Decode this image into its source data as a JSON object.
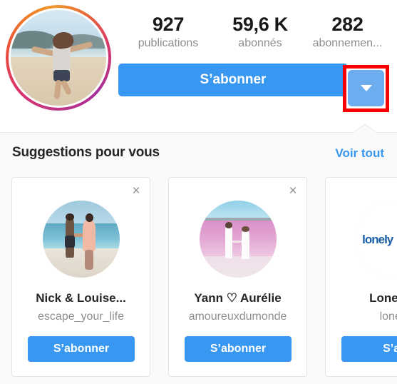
{
  "profile": {
    "avatar_alt": "woman running on beach",
    "has_story_ring": true,
    "stats": [
      {
        "value": "927",
        "label": "publications"
      },
      {
        "value": "59,6 K",
        "label": "abonnés"
      },
      {
        "value": "282",
        "label": "abonnemen..."
      }
    ],
    "follow_label": "S’abonner",
    "dropdown_icon": "chevron-down-icon"
  },
  "annotation": {
    "color": "#f60000",
    "target": "follow-options-dropdown"
  },
  "suggestions": {
    "title": "Suggestions pour vous",
    "see_all_label": "Voir tout",
    "close_icon": "×",
    "cards": [
      {
        "name": "Nick & Louise...",
        "username": "escape_your_life",
        "follow_label": "S’abonner",
        "avatar_alt": "couple holding hands on beach"
      },
      {
        "name": "Yann ♡ Aurélie",
        "username": "amoureuxdumonde",
        "follow_label": "S’abonner",
        "avatar_alt": "couple at pink lake"
      },
      {
        "name": "Lonely P",
        "username": "lonely",
        "follow_label": "S’ab",
        "avatar_alt": "lonely planet logo",
        "logo_text": "lonely"
      }
    ]
  },
  "colors": {
    "instagram_blue": "#3897f0",
    "dropdown_blue": "#6cadf0",
    "annotation_red": "#f60000",
    "panel_bg": "#fafafa",
    "muted_text": "#8e8e8e"
  }
}
